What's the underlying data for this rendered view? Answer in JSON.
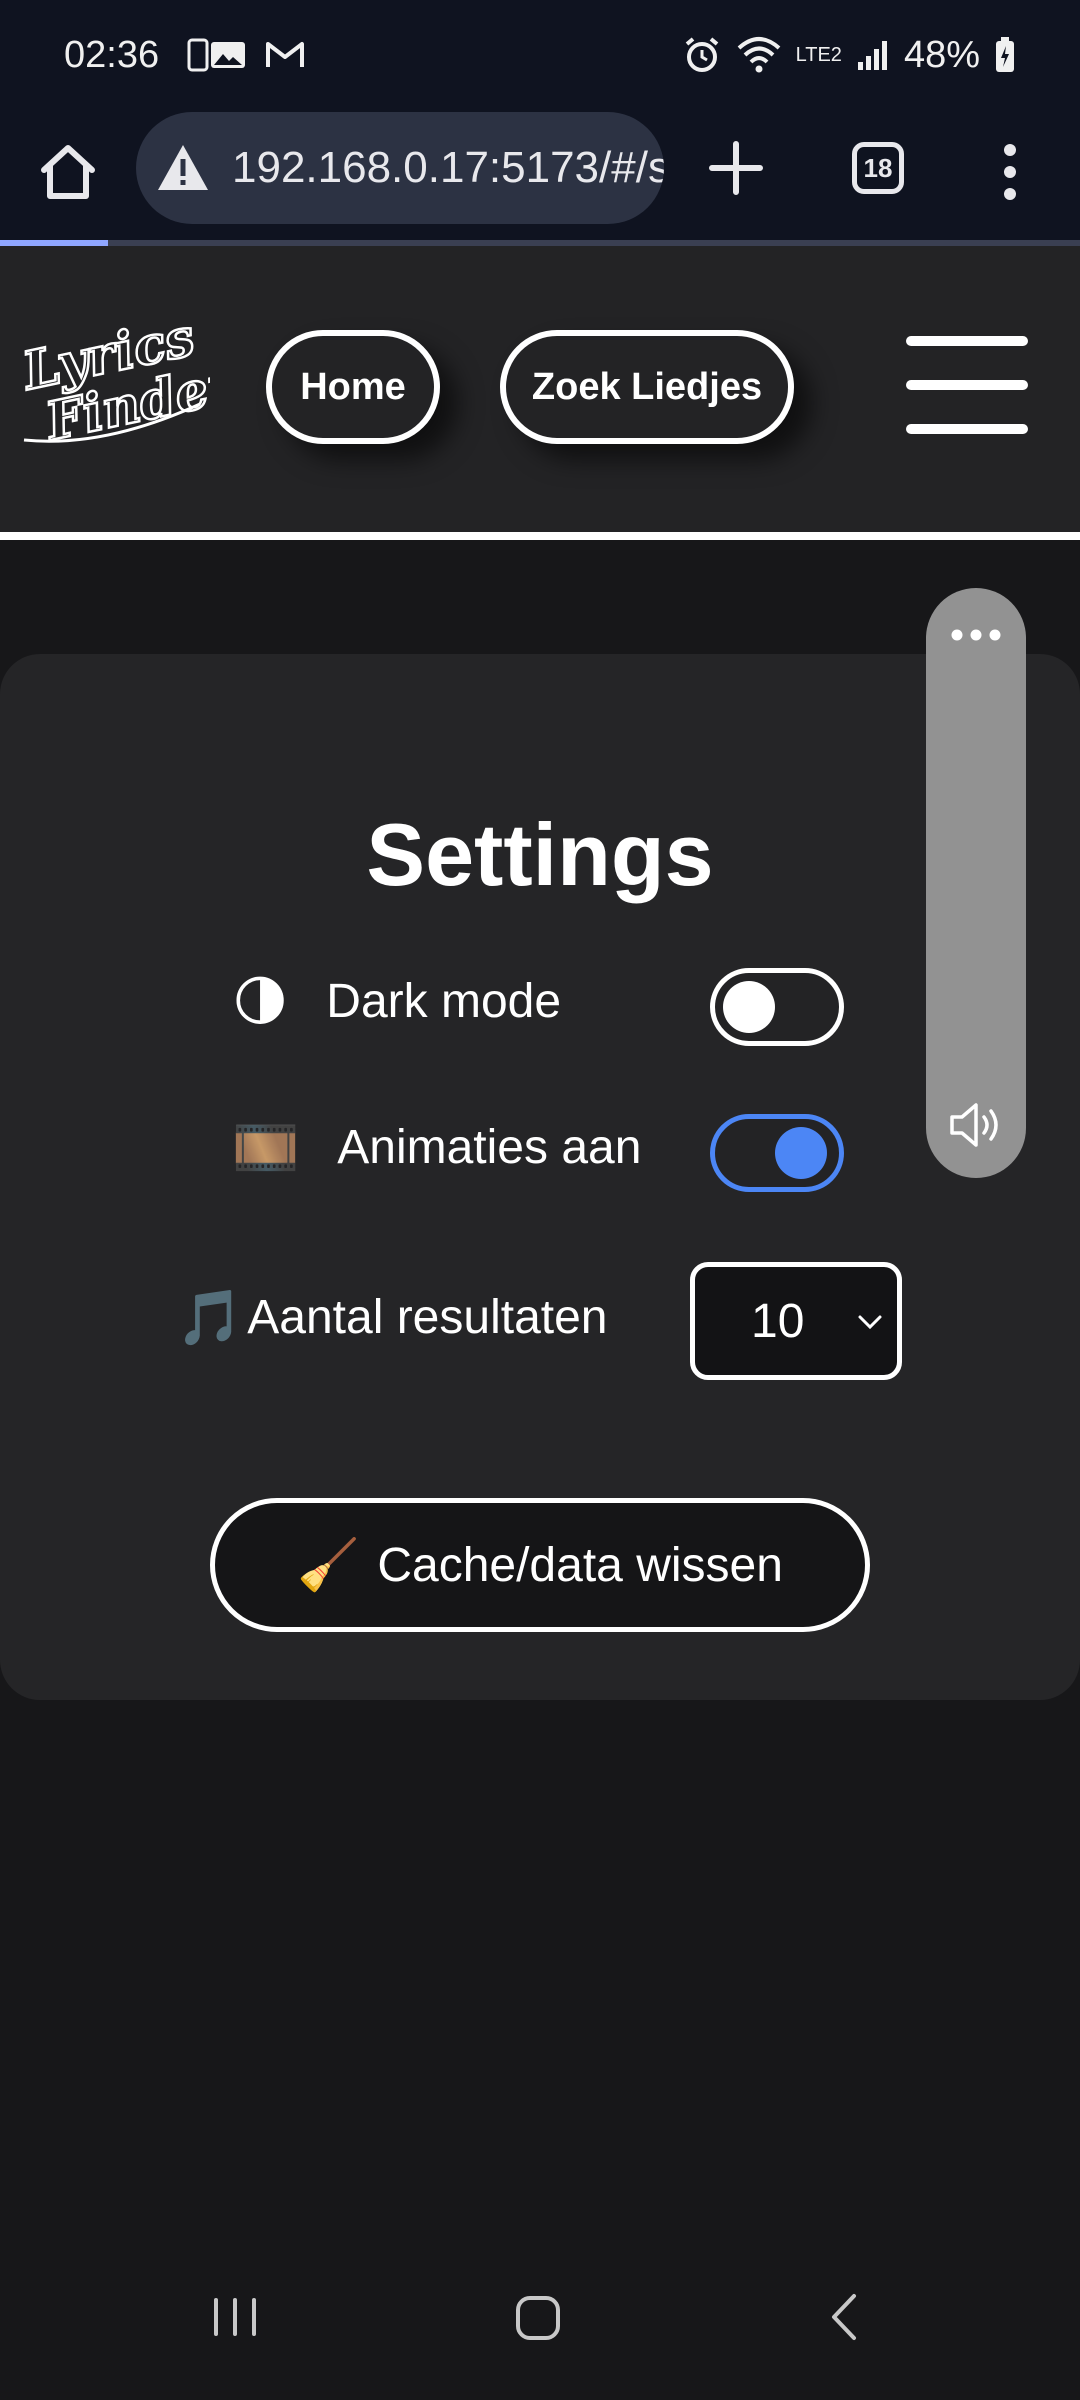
{
  "status_bar": {
    "time": "02:36",
    "battery": "48%",
    "network": "LTE2"
  },
  "browser": {
    "url": "192.168.0.17:5173/#/s",
    "tab_count": "18",
    "page_load_progress": 0.1
  },
  "site": {
    "logo_text": "Lyrics Finder",
    "nav": {
      "home": "Home",
      "search": "Zoek Liedjes"
    }
  },
  "settings": {
    "title": "Settings",
    "dark_mode": {
      "icon": "🌗",
      "label": "Dark mode",
      "enabled": false
    },
    "animations": {
      "icon": "🎞️",
      "label": "Animaties aan",
      "enabled": true
    },
    "results": {
      "icon": "🎵",
      "label": "Aantal resultaten",
      "value": "10"
    },
    "clear_cache": {
      "icon": "🧹",
      "label": "Cache/data wissen"
    }
  },
  "colors": {
    "accent": "#4c86f5",
    "card_bg": "#252527",
    "page_bg": "#171719",
    "browser_bg": "#0f1320"
  }
}
